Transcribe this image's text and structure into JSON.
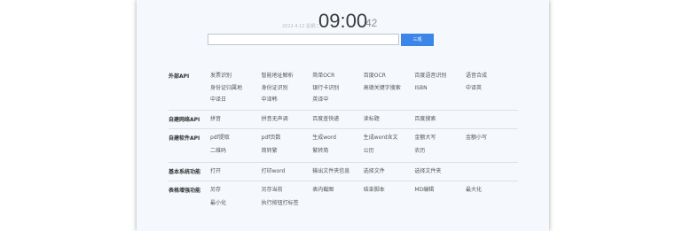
{
  "clock": {
    "date": "2022.4.12 星期二",
    "time": "09:00",
    "seconds": "42"
  },
  "search": {
    "value": "",
    "button_label": "三观"
  },
  "sections": [
    {
      "title": "外部API",
      "items": [
        "发票识别",
        "智能地址解析",
        "简单OCR",
        "百度OCR",
        "百度语音识别",
        "语音合成",
        "身份证归属地",
        "身份证识别",
        "银行卡识别",
        "高德关键字搜索",
        "ISBN",
        "中译英",
        "中译日",
        "中译韩",
        "英译中"
      ]
    },
    {
      "title": "自建网络API",
      "items": [
        "拼音",
        "拼音无声调",
        "百度查快递",
        "读标题",
        "百度搜索"
      ]
    },
    {
      "title": "自建软件API",
      "items": [
        "pdf提取",
        "pdf页数",
        "生成word",
        "生成word含文",
        "金额大写",
        "金额小写",
        "二维码",
        "简转繁",
        "繁转简",
        "公历",
        "农历"
      ]
    },
    {
      "title": "基本系统功能",
      "items": [
        "打开",
        "打印word",
        "输出文件夹信息",
        "选择文件",
        "选择文件夹"
      ]
    },
    {
      "title": "表格增强功能",
      "items": [
        "另存",
        "另存当前",
        "表内截图",
        "结束脚本",
        "MD编辑",
        "最大化",
        "最小化",
        "执行按钮打标签"
      ]
    }
  ]
}
